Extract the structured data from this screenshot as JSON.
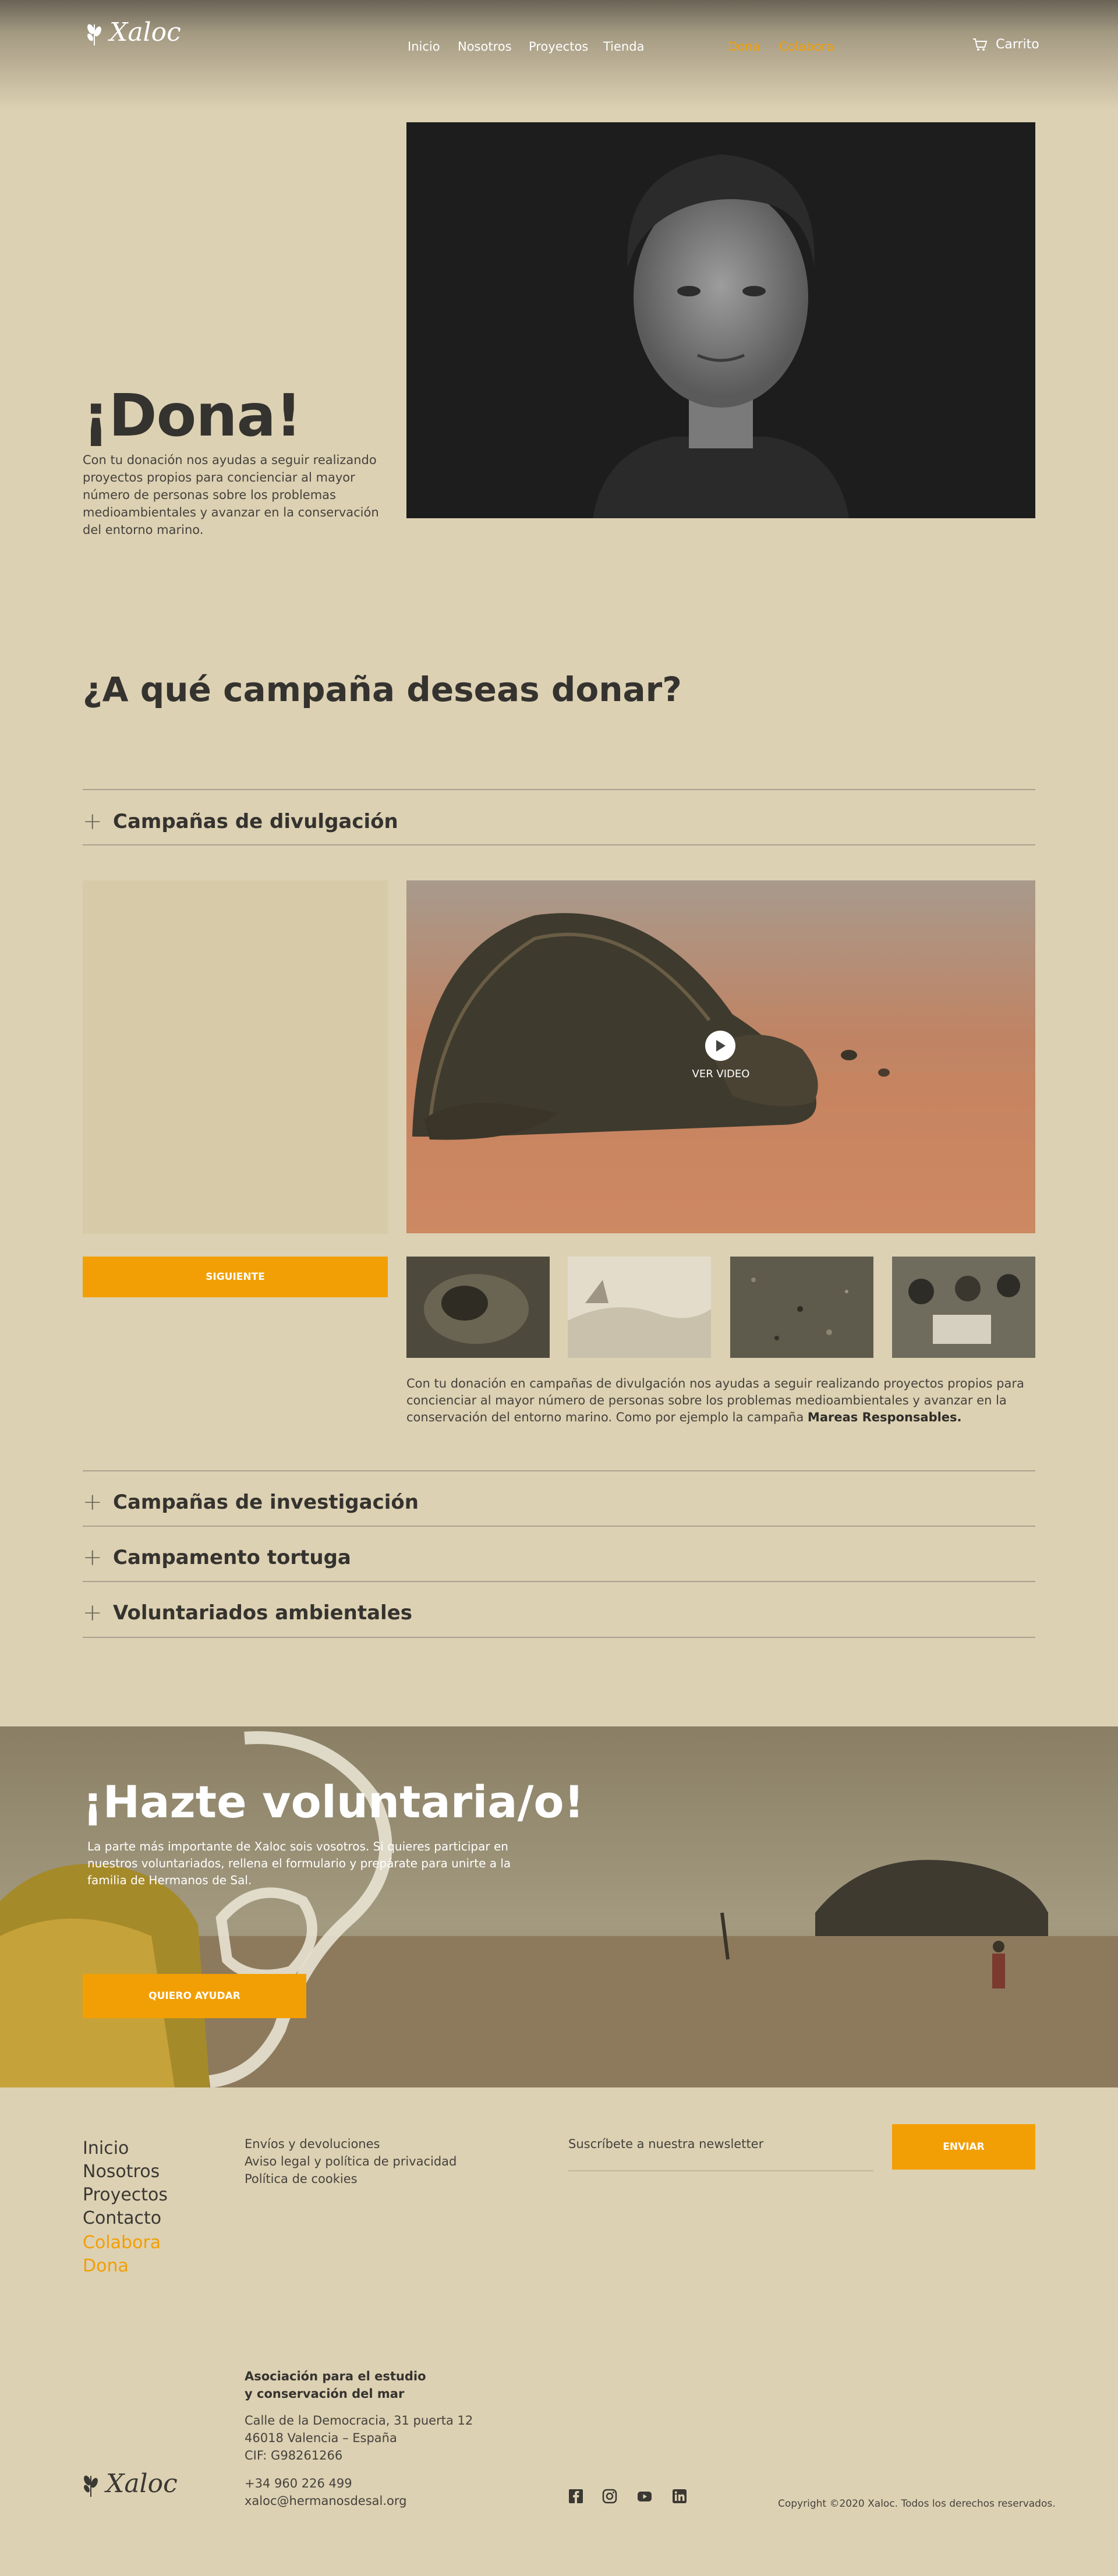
{
  "header": {
    "logo": "Xaloc",
    "nav": [
      "Inicio",
      "Nosotros",
      "Proyectos",
      "Tienda"
    ],
    "accent_nav": [
      "Dona",
      "Colabora"
    ],
    "cart": "Carrito"
  },
  "hero": {
    "title": "¡Dona!",
    "text": "Con tu donación nos ayudas a seguir realizando proyectos propios para concienciar al mayor número de personas sobre los problemas medioambientales y avanzar en la conservación del entorno marino."
  },
  "campaign": {
    "title": "¿A qué campaña deseas donar?",
    "open_section": "Campañas de divulgación",
    "next_button": "SIGUIENTE",
    "video_label": "VER VIDEO",
    "description": "Con tu donación en campañas de divulgación nos ayudas a seguir realizando proyectos propios para concienciar al mayor número de personas sobre los problemas medioambientales y avanzar en la conservación del entorno marino. Como por ejemplo la campaña",
    "description_bold": "Mareas Responsables.",
    "other_sections": [
      "Campañas de investigación",
      "Campamento tortuga",
      "Voluntariados ambientales"
    ]
  },
  "volunteer": {
    "title": "¡Hazte voluntaria/o!",
    "text": "La parte más importante de Xaloc sois vosotros. Si quieres participar en nuestros voluntariados, rellena el formulario y prepárate para unirte a la familia de Hermanos de Sal.",
    "button": "QUIERO AYUDAR"
  },
  "footer": {
    "nav": [
      "Inicio",
      "Nosotros",
      "Proyectos",
      "Contacto"
    ],
    "accent_nav": [
      "Colabora",
      "Dona"
    ],
    "links": [
      "Envíos y devoluciones",
      "Aviso legal y política de privacidad",
      "Política de cookies"
    ],
    "newsletter_placeholder": "Suscríbete a nuestra newsletter",
    "send_button": "ENVIAR",
    "org_line1": "Asociación para el estudio",
    "org_line2": "y conservación del mar",
    "address1": "Calle de la Democracia, 31 puerta 12",
    "address2": "46018 Valencia – España",
    "cif": "CIF: G98261266",
    "phone": "+34 960 226 499",
    "email": "xaloc@hermanosdesal.org",
    "logo": "Xaloc",
    "social": [
      "facebook-icon",
      "instagram-icon",
      "youtube-icon",
      "linkedin-icon"
    ],
    "copyright": "Copyright ©2020 Xaloc. Todos los derechos reservados."
  },
  "colors": {
    "background": "#ddd1b3",
    "accent": "#f29f05",
    "dark_text": "#35332f"
  }
}
